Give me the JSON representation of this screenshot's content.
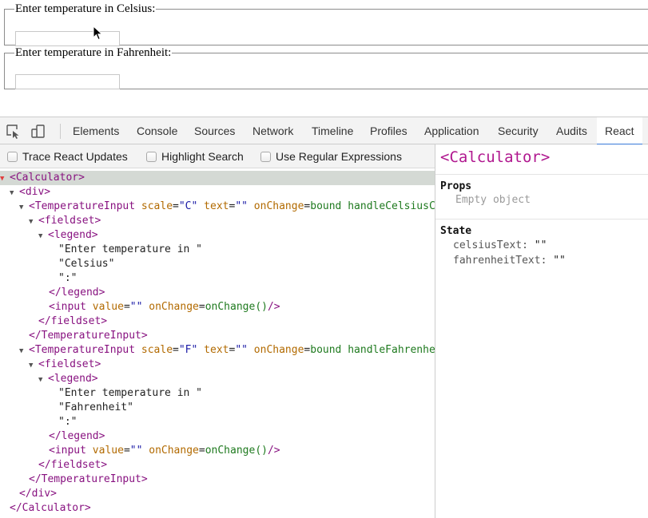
{
  "app": {
    "celsius_legend": "Enter temperature in Celsius:",
    "celsius_value": "",
    "fahrenheit_legend": "Enter temperature in Fahrenheit:",
    "fahrenheit_value": ""
  },
  "devtools": {
    "tabs": [
      "Elements",
      "Console",
      "Sources",
      "Network",
      "Timeline",
      "Profiles",
      "Application",
      "Security",
      "Audits",
      "React"
    ],
    "active_tab": "React",
    "options": [
      "Trace React Updates",
      "Highlight Search",
      "Use Regular Expressions"
    ],
    "tree": {
      "calc_open": "<Calculator>",
      "div_open": "<div>",
      "ti_open": "<TemperatureInput",
      "scale_attr": "scale",
      "c_val": "\"C\"",
      "f_val": "\"F\"",
      "text_attr": "text",
      "text_val": "\"\"",
      "onchange_attr": "onChange",
      "handle_c": "bound handleCelsiusChange()",
      "handle_f": "bound handleFahrenheitChange()",
      "gt": ">",
      "fieldset_open": "<fieldset>",
      "legend_open": "<legend>",
      "enter_str": "\"Enter temperature in \"",
      "celsius_str": "\"Celsius\"",
      "fahrenheit_str": "\"Fahrenheit\"",
      "colon_str": "\":\"",
      "legend_close": "</legend>",
      "input_open": "<input",
      "value_attr": "value",
      "value_val": "\"\"",
      "onchange_fn": "onChange()",
      "self_close": "/>",
      "fieldset_close": "</fieldset>",
      "ti_close": "</TemperatureInput>",
      "div_close": "</div>",
      "calc_close": "</Calculator>"
    },
    "sidebar": {
      "title": "<Calculator>",
      "props_label": "Props",
      "props_empty": "Empty object",
      "state_label": "State",
      "state": [
        {
          "key": "celsiusText:",
          "value": "\"\""
        },
        {
          "key": "fahrenheitText:",
          "value": "\"\""
        }
      ]
    }
  }
}
